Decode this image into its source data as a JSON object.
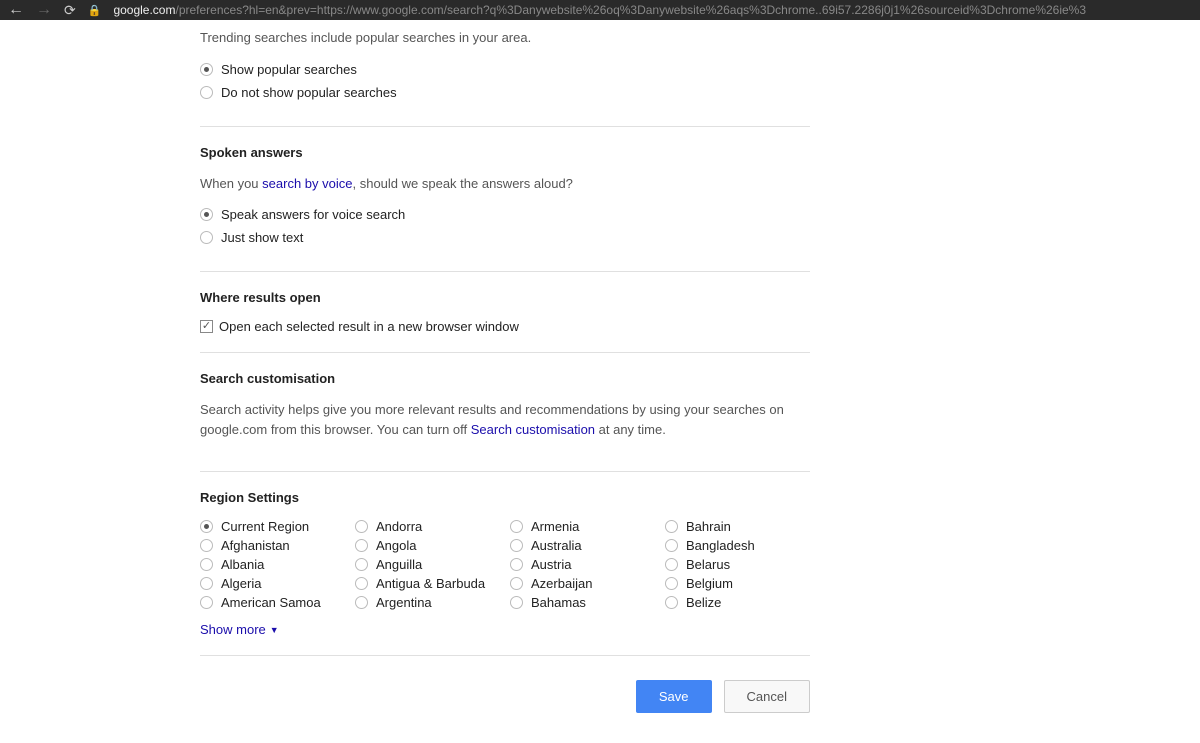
{
  "browser": {
    "url_domain": "google.com",
    "url_path": "/preferences?hl=en&prev=https://www.google.com/search?q%3Danywebsite%26oq%3Danywebsite%26aqs%3Dchrome..69i57.2286j0j1%26sourceid%3Dchrome%26ie%3"
  },
  "trending": {
    "desc": "Trending searches include popular searches in your area.",
    "opt_show": "Show popular searches",
    "opt_hide": "Do not show popular searches"
  },
  "spoken": {
    "title": "Spoken answers",
    "desc_pre": "When you ",
    "desc_link": "search by voice",
    "desc_post": ", should we speak the answers aloud?",
    "opt_speak": "Speak answers for voice search",
    "opt_text": "Just show text"
  },
  "where_open": {
    "title": "Where results open",
    "check_label": "Open each selected result in a new browser window"
  },
  "search_custom": {
    "title": "Search customisation",
    "desc_pre": "Search activity helps give you more relevant results and recommendations by using your searches on google.com from this browser. You can turn off ",
    "desc_link": "Search customisation",
    "desc_post": " at any time."
  },
  "region": {
    "title": "Region Settings",
    "cols": [
      [
        "Current Region",
        "Afghanistan",
        "Albania",
        "Algeria",
        "American Samoa"
      ],
      [
        "Andorra",
        "Angola",
        "Anguilla",
        "Antigua & Barbuda",
        "Argentina"
      ],
      [
        "Armenia",
        "Australia",
        "Austria",
        "Azerbaijan",
        "Bahamas"
      ],
      [
        "Bahrain",
        "Bangladesh",
        "Belarus",
        "Belgium",
        "Belize"
      ]
    ],
    "show_more": "Show more"
  },
  "buttons": {
    "save": "Save",
    "cancel": "Cancel"
  }
}
